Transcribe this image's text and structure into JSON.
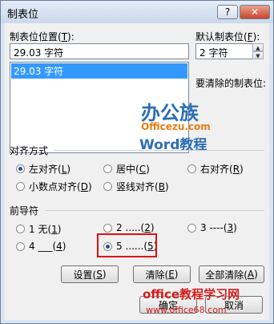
{
  "title": "制表位",
  "tab_position": {
    "label": "制表位位置(",
    "key": "T",
    "close": "):",
    "value": "29.03 字符",
    "list": [
      "29.03 字符"
    ]
  },
  "default_tab": {
    "label": "默认制表位(",
    "key": "F",
    "close": "):",
    "value": "2 字符"
  },
  "clear_label": "要清除的制表位:",
  "watermark": {
    "logo": "办公族",
    "site": "Officezu.com",
    "sub": "Word教程",
    "bottom": "office教程学习网",
    "url": "www.office68.com"
  },
  "alignment": {
    "title": "对齐方式",
    "options": [
      {
        "text": "左对齐(",
        "key": "L",
        "end": ")",
        "checked": true
      },
      {
        "text": "居中(",
        "key": "C",
        "end": ")",
        "checked": false
      },
      {
        "text": "右对齐(",
        "key": "R",
        "end": ")",
        "checked": false
      },
      {
        "text": "小数点对齐(",
        "key": "D",
        "end": ")",
        "checked": false
      },
      {
        "text": "竖线对齐(",
        "key": "B",
        "end": ")",
        "checked": false
      }
    ]
  },
  "leader": {
    "title": "前导符",
    "options": [
      {
        "text": "1 无(",
        "key": "1",
        "end": ")",
        "checked": false
      },
      {
        "text": "2 .....(",
        "key": "2",
        "end": ")",
        "checked": false
      },
      {
        "text": "3 ----(",
        "key": "3",
        "end": ")",
        "checked": false
      },
      {
        "text": "4 ___(",
        "key": "4",
        "end": ")",
        "checked": false
      },
      {
        "text": "5 ......(",
        "key": "5",
        "end": ")",
        "checked": true
      }
    ]
  },
  "buttons": {
    "set": {
      "text": "设置(",
      "key": "S",
      "end": ")"
    },
    "clear": {
      "text": "清除(",
      "key": "E",
      "end": ")"
    },
    "clear_all": {
      "text": "全部清除(",
      "key": "A",
      "end": ")"
    },
    "ok": "确定",
    "cancel": "取消"
  },
  "titlebar": {
    "help": "?",
    "close": "✕"
  }
}
